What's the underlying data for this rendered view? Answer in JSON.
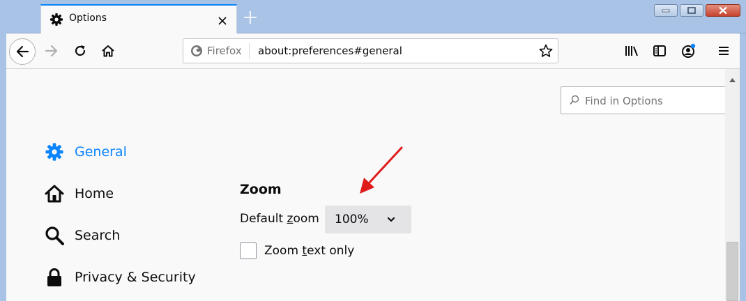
{
  "browser": {
    "tab": {
      "title": "Options",
      "icon": "gear-icon"
    },
    "new_tab_icon": "plus-icon",
    "urlbar": {
      "identity_label": "Firefox",
      "url": "about:preferences#general",
      "bookmark_icon": "star-icon"
    },
    "toolbar_icons": [
      "back-icon",
      "forward-icon",
      "reload-icon",
      "home-icon",
      "library-icon",
      "sidebar-icon",
      "account-icon",
      "menu-icon"
    ],
    "window_controls": [
      "minimize-icon",
      "maximize-icon",
      "close-icon"
    ],
    "accent_color": "#0a84ff"
  },
  "options": {
    "search": {
      "placeholder": "Find in Options"
    },
    "categories": [
      {
        "label": "General",
        "icon": "gear-icon",
        "selected": true
      },
      {
        "label": "Home",
        "icon": "home-icon",
        "selected": false
      },
      {
        "label": "Search",
        "icon": "search-icon",
        "selected": false
      },
      {
        "label": "Privacy & Security",
        "icon": "lock-icon",
        "selected": false
      }
    ],
    "zoom": {
      "heading": "Zoom",
      "default_zoom_label_before": "Default ",
      "default_zoom_label_key": "z",
      "default_zoom_label_after": "oom",
      "default_zoom_value": "100%",
      "text_only_label_before": "Zoom ",
      "text_only_label_key": "t",
      "text_only_label_after": "ext only",
      "text_only_checked": false
    },
    "annotation": {
      "arrow_color": "#e01b1b"
    }
  }
}
